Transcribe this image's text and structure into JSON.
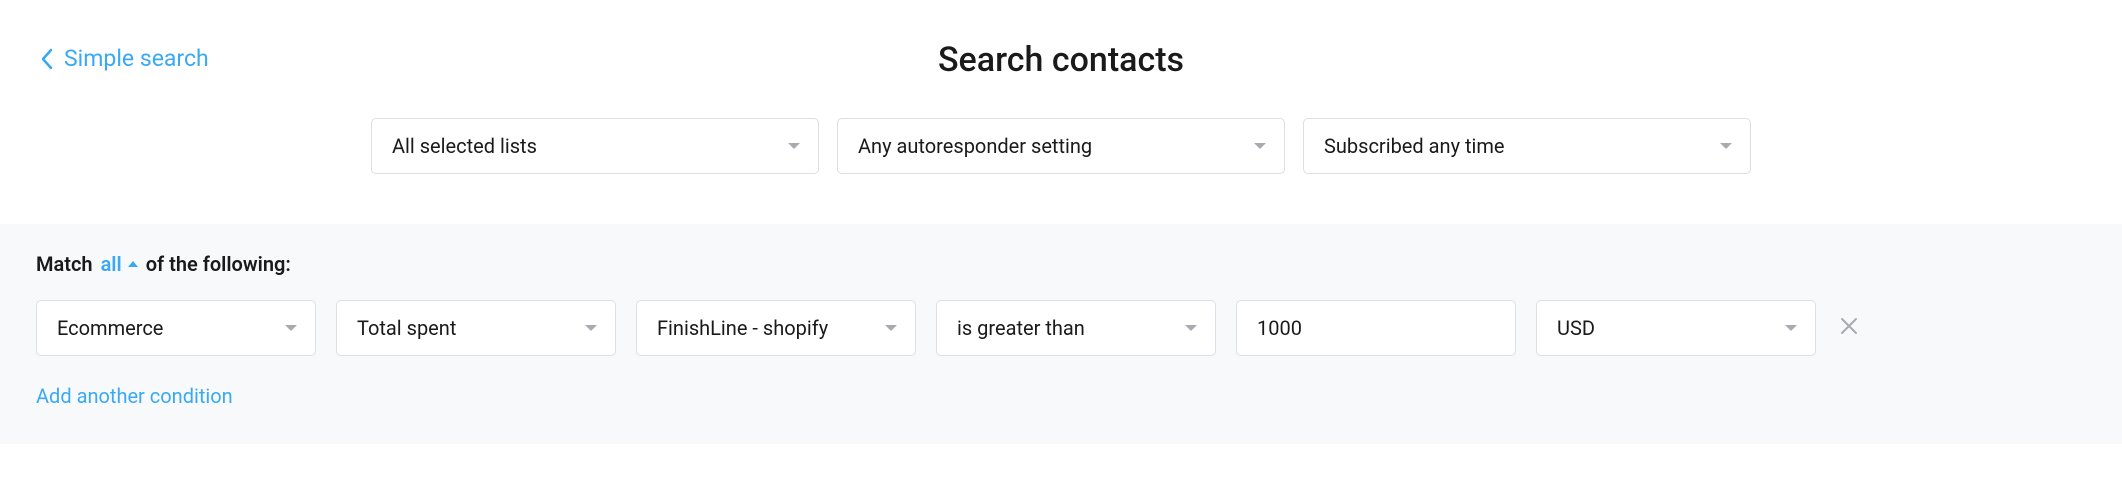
{
  "backLink": "Simple search",
  "title": "Search contacts",
  "filters": {
    "lists": "All selected lists",
    "autoresponder": "Any autoresponder setting",
    "subscribed": "Subscribed any time"
  },
  "match": {
    "prefix": "Match",
    "mode": "all",
    "suffix": "of the following:"
  },
  "condition": {
    "category": "Ecommerce",
    "metric": "Total spent",
    "store": "FinishLine - shopify",
    "operator": "is greater than",
    "value": "1000",
    "currency": "USD"
  },
  "addCondition": "Add another condition"
}
